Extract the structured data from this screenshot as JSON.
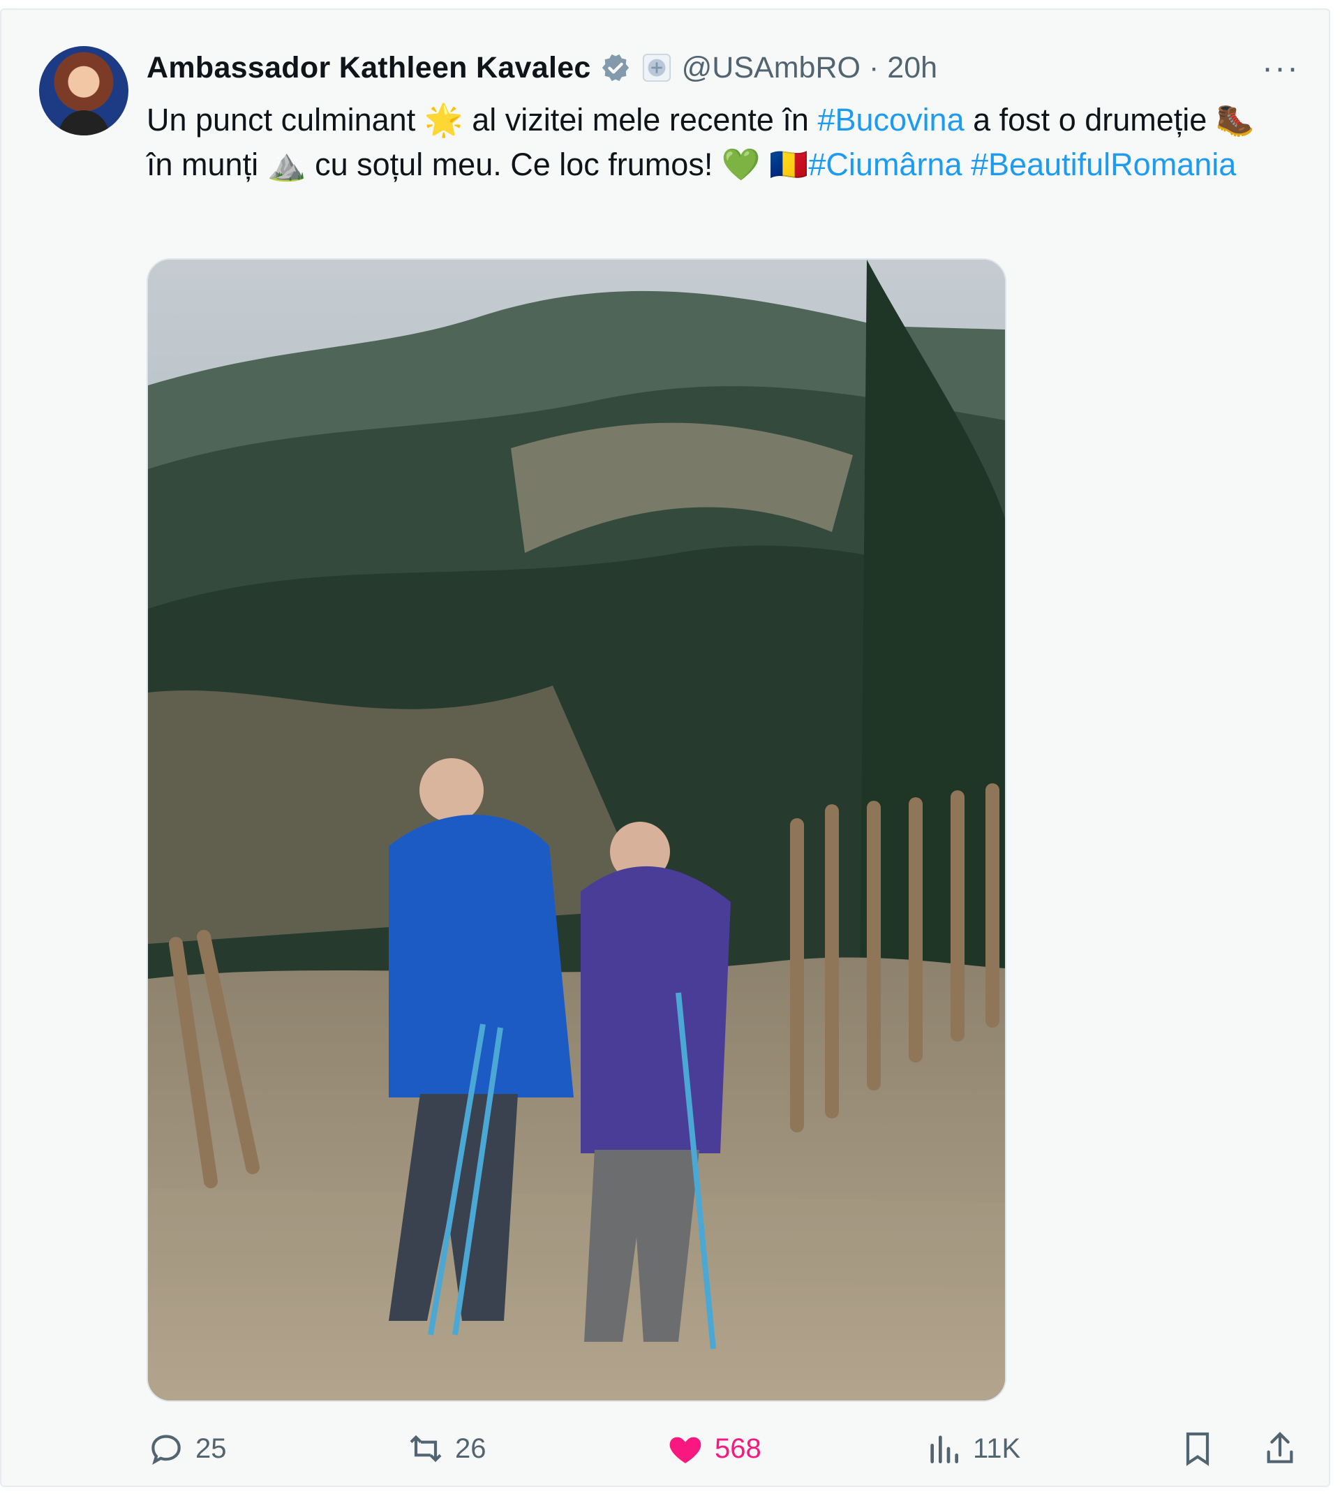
{
  "tweet": {
    "author_name": "Ambassador Kathleen Kavalec",
    "handle": "@USAmbRO",
    "separator": "·",
    "time": "20h",
    "more_label": "···",
    "text_parts": [
      "Un punct culminant 🌟 al vizitei mele recente în ",
      "#Bucovina",
      " a fost o drumeție 🥾 în munți ⛰️ cu soțul meu. Ce loc frumos! 💚 🇷🇴",
      "#Ciumârna",
      " ",
      "#BeautifulRomania"
    ],
    "metrics": {
      "replies": "25",
      "reposts": "26",
      "likes": "568",
      "views": "11K"
    },
    "colors": {
      "accent": "#1d9bf0",
      "like": "#f91880",
      "secondary": "#536471"
    }
  }
}
